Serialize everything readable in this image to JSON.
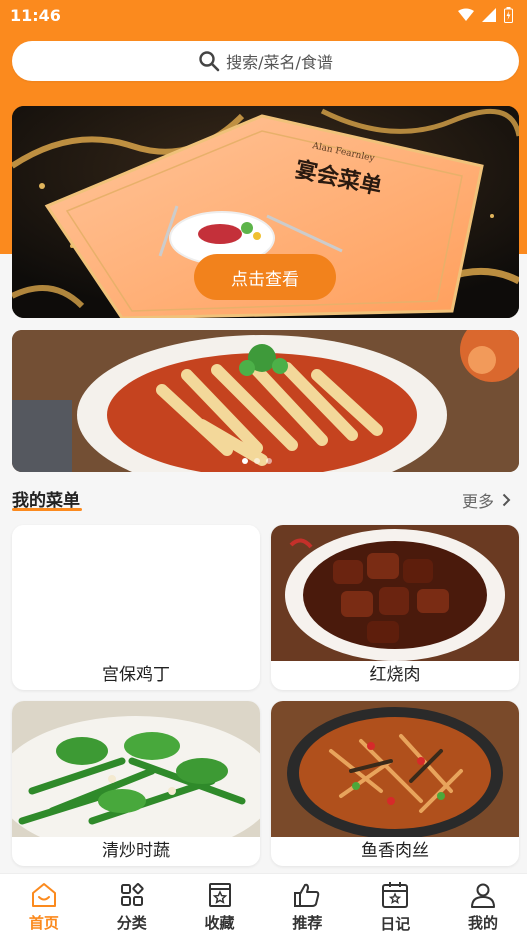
{
  "status_bar": {
    "time": "11:46"
  },
  "search": {
    "placeholder": "搜索/菜名/食谱",
    "icon": "search-icon"
  },
  "banner": {
    "menu_title": "宴会菜单",
    "menu_signature": "Alan Fearnley",
    "button_label": "点击查看"
  },
  "carousel": {
    "image": "yuba-dish-photo",
    "dots": 3,
    "active_dot": 0
  },
  "my_menu": {
    "title": "我的菜单",
    "more_label": "更多",
    "items": [
      {
        "name": "宫保鸡丁",
        "image": "blank"
      },
      {
        "name": "红烧肉",
        "image": "braised-pork-photo"
      },
      {
        "name": "清炒时蔬",
        "image": "stir-fried-greens-photo"
      },
      {
        "name": "鱼香肉丝",
        "image": "yuxiang-pork-photo"
      }
    ]
  },
  "bottom_nav": [
    {
      "label": "首页",
      "icon": "home-icon",
      "active": true
    },
    {
      "label": "分类",
      "icon": "category-icon",
      "active": false
    },
    {
      "label": "收藏",
      "icon": "favorites-icon",
      "active": false
    },
    {
      "label": "推荐",
      "icon": "thumbs-up-icon",
      "active": false
    },
    {
      "label": "日记",
      "icon": "calendar-icon",
      "active": false
    },
    {
      "label": "我的",
      "icon": "user-icon",
      "active": false
    }
  ],
  "colors": {
    "accent": "#fb8a1e",
    "background": "#f6f6f6"
  }
}
